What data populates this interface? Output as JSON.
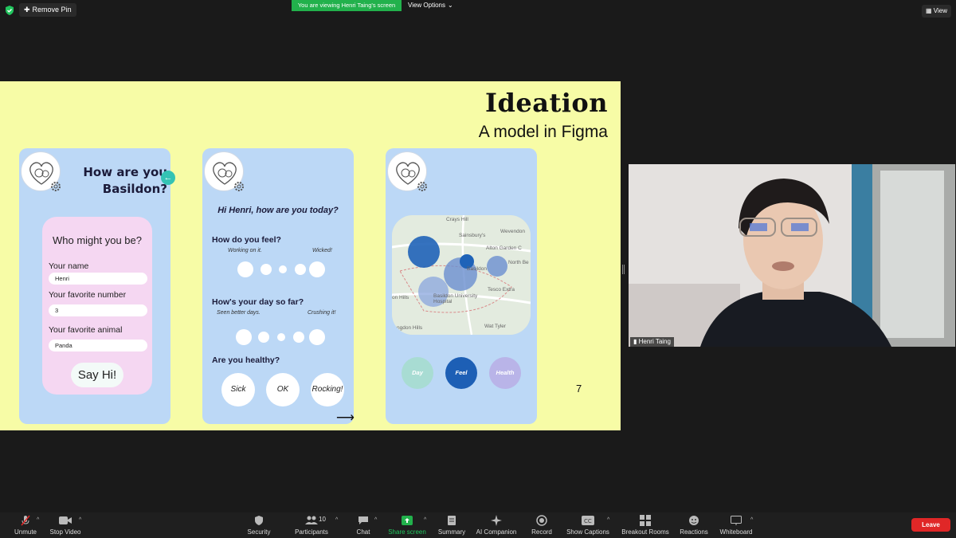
{
  "topbar": {
    "remove_pin": "Remove Pin",
    "viewing_banner": "You are viewing Henri Taing's screen",
    "view_options": "View Options",
    "view": "View"
  },
  "slide": {
    "title": "Ideation",
    "subtitle": "A model in Figma",
    "page_number": "7",
    "screen1": {
      "heading": "How are you Basildon?",
      "form_heading": "Who might you be?",
      "fields": [
        {
          "label": "Your name",
          "value": "Henri"
        },
        {
          "label": "Your favorite number",
          "value": "3"
        },
        {
          "label": "Your favorite animal",
          "value": "Panda"
        }
      ],
      "button": "Say Hi!"
    },
    "screen2": {
      "greeting": "Hi Henri, how are you today?",
      "q1": "How do you feel?",
      "q1_low": "Working on it.",
      "q1_high": "Wicked!",
      "q2": "How's your day so far?",
      "q2_low": "Seen better days.",
      "q2_high": "Crushing it!",
      "q3": "Are you healthy?",
      "options": [
        "Sick",
        "OK",
        "Rocking!"
      ],
      "arrow": "⟶"
    },
    "screen3": {
      "map_labels": [
        "Crays Hill",
        "Sainsbury's",
        "Wevendon",
        "Alton Garden C",
        "North Be",
        "Basildon",
        "Tesco Extra",
        "on Hills",
        "Basildon University Hospital",
        "ngdon Hills",
        "Wat Tyler"
      ],
      "tabs": [
        {
          "label": "Day",
          "color": "#a8dcd3"
        },
        {
          "label": "Feel",
          "color": "#1d5fb5"
        },
        {
          "label": "Health",
          "color": "#b9b4e8"
        }
      ]
    }
  },
  "webcam": {
    "name": "Henri Taing"
  },
  "toolbar": {
    "items": [
      {
        "label": "Unmute",
        "icon": "muted-mic-icon"
      },
      {
        "label": "Stop Video",
        "icon": "video-camera-icon"
      },
      {
        "label": "Security",
        "icon": "shield-icon"
      },
      {
        "label": "Participants",
        "icon": "participants-icon",
        "count": "10"
      },
      {
        "label": "Chat",
        "icon": "chat-icon"
      },
      {
        "label": "Share screen",
        "icon": "share-screen-icon"
      },
      {
        "label": "Summary",
        "icon": "summary-icon"
      },
      {
        "label": "AI Companion",
        "icon": "sparkle-icon"
      },
      {
        "label": "Record",
        "icon": "record-icon"
      },
      {
        "label": "Show Captions",
        "icon": "captions-icon"
      },
      {
        "label": "Breakout Rooms",
        "icon": "breakout-rooms-icon"
      },
      {
        "label": "Reactions",
        "icon": "reactions-icon"
      },
      {
        "label": "Whiteboard",
        "icon": "whiteboard-icon"
      }
    ],
    "leave": "Leave",
    "colors": {
      "share_green": "#22b14c",
      "leave_red": "#e02727"
    }
  }
}
